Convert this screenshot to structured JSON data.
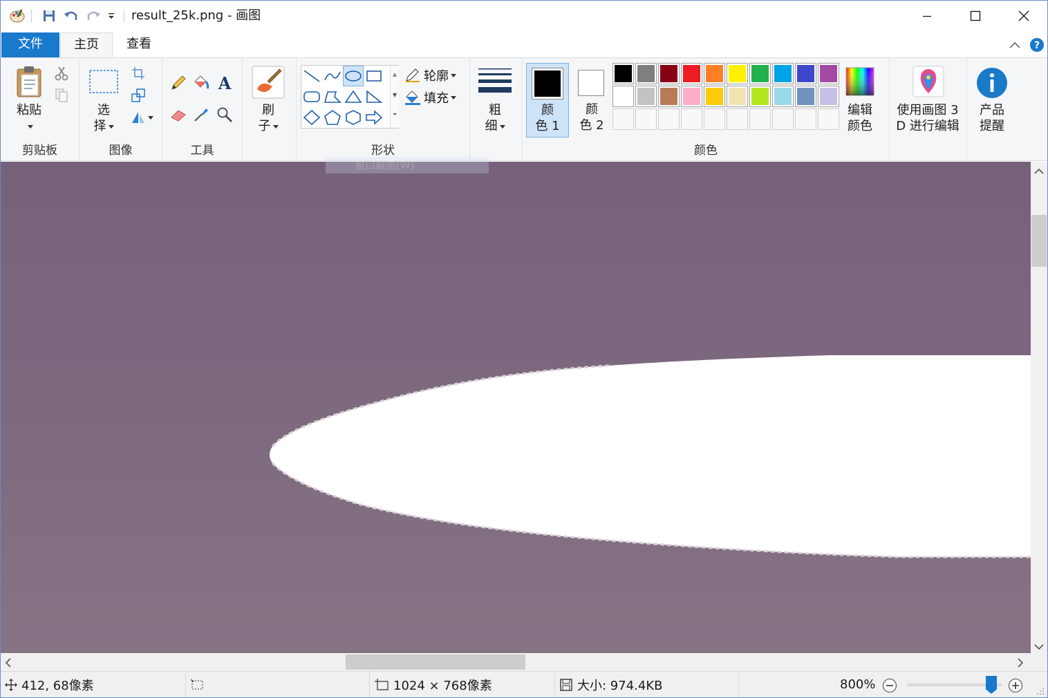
{
  "window": {
    "title": "result_25k.png - 画图"
  },
  "tabs": [
    {
      "label": "文件"
    },
    {
      "label": "主页"
    },
    {
      "label": "查看"
    }
  ],
  "ribbon": {
    "clipboard": {
      "paste_label": "粘贴",
      "group_label": "剪贴板"
    },
    "image": {
      "select_label_1": "选",
      "select_label_2": "择",
      "group_label": "图像"
    },
    "tools": {
      "group_label": "工具"
    },
    "brushes": {
      "label_1": "刷",
      "label_2": "子"
    },
    "shapes": {
      "outline_label": "轮廓",
      "fill_label": "填充",
      "group_label": "形状"
    },
    "size": {
      "label_1": "粗",
      "label_2": "细"
    },
    "colors": {
      "color1_label_1": "颜",
      "color1_label_2": "色 1",
      "color2_label_1": "颜",
      "color2_label_2": "色 2",
      "edit_label_1": "编辑",
      "edit_label_2": "颜色",
      "group_label": "颜色",
      "color1_value": "#000000",
      "color2_value": "#ffffff",
      "palette_row1": [
        "#000000",
        "#7f7f7f",
        "#880015",
        "#ed1c24",
        "#ff7f27",
        "#fff200",
        "#22b14c",
        "#00a2e8",
        "#3f48cc",
        "#a349a4"
      ],
      "palette_row2": [
        "#ffffff",
        "#c3c3c3",
        "#b97a57",
        "#ffaec9",
        "#ffc90e",
        "#efe4b0",
        "#b5e61d",
        "#99d9ea",
        "#7092be",
        "#c8bfe7"
      ]
    },
    "paint3d": {
      "label_1": "使用画图 3",
      "label_2": "D 进行编辑"
    },
    "alert": {
      "label_1": "产品",
      "label_2": "提醒"
    }
  },
  "canvas": {
    "tooltip": "窗口截图(W)",
    "background_color": "#7d6a7b",
    "shape_color": "#ffffff"
  },
  "statusbar": {
    "cursor_pos": "412, 68像素",
    "image_size": "1024 × 768像素",
    "file_size": "大小: 974.4KB",
    "zoom": "800%"
  }
}
